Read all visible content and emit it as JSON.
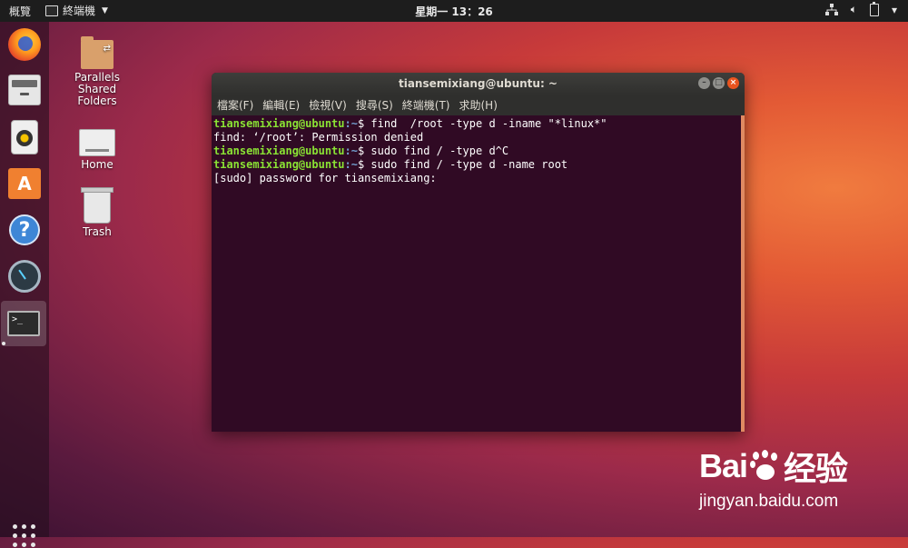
{
  "top_panel": {
    "activities": "概覽",
    "app_menu": "終端機",
    "clock": "星期一 13：26"
  },
  "dock": {
    "items": [
      "firefox-icon",
      "files-icon",
      "rhythmbox-icon",
      "software-icon",
      "help-icon",
      "gauge-icon",
      "terminal-icon"
    ],
    "show_apps": "apps-grid-icon"
  },
  "desktop": {
    "icons": [
      {
        "label": "Parallels\nShared\nFolders"
      },
      {
        "label": "Home"
      },
      {
        "label": "Trash"
      }
    ]
  },
  "terminal": {
    "title": "tiansemixiang@ubuntu: ~",
    "menu": [
      "檔案(F)",
      "編輯(E)",
      "檢視(V)",
      "搜尋(S)",
      "終端機(T)",
      "求助(H)"
    ],
    "lines": [
      {
        "user": "tiansemixiang@ubuntu",
        "path": ":~",
        "text": "$ find  /root -type d -iname \"*linux*\""
      },
      {
        "text": "find: ‘/root’: Permission denied"
      },
      {
        "user": "tiansemixiang@ubuntu",
        "path": ":~",
        "text": "$ sudo find / -type d^C"
      },
      {
        "user": "tiansemixiang@ubuntu",
        "path": ":~",
        "text": "$ sudo find / -type d -name root"
      },
      {
        "text": "[sudo] password for tiansemixiang:"
      }
    ]
  },
  "watermark": {
    "brand_left": "Bai",
    "brand_right": "经验",
    "url": "jingyan.baidu.com"
  },
  "colors": {
    "terminal_bg": "#300a24",
    "prompt_user": "#8ae234",
    "prompt_path": "#729fcf",
    "close_button": "#e9541f"
  }
}
